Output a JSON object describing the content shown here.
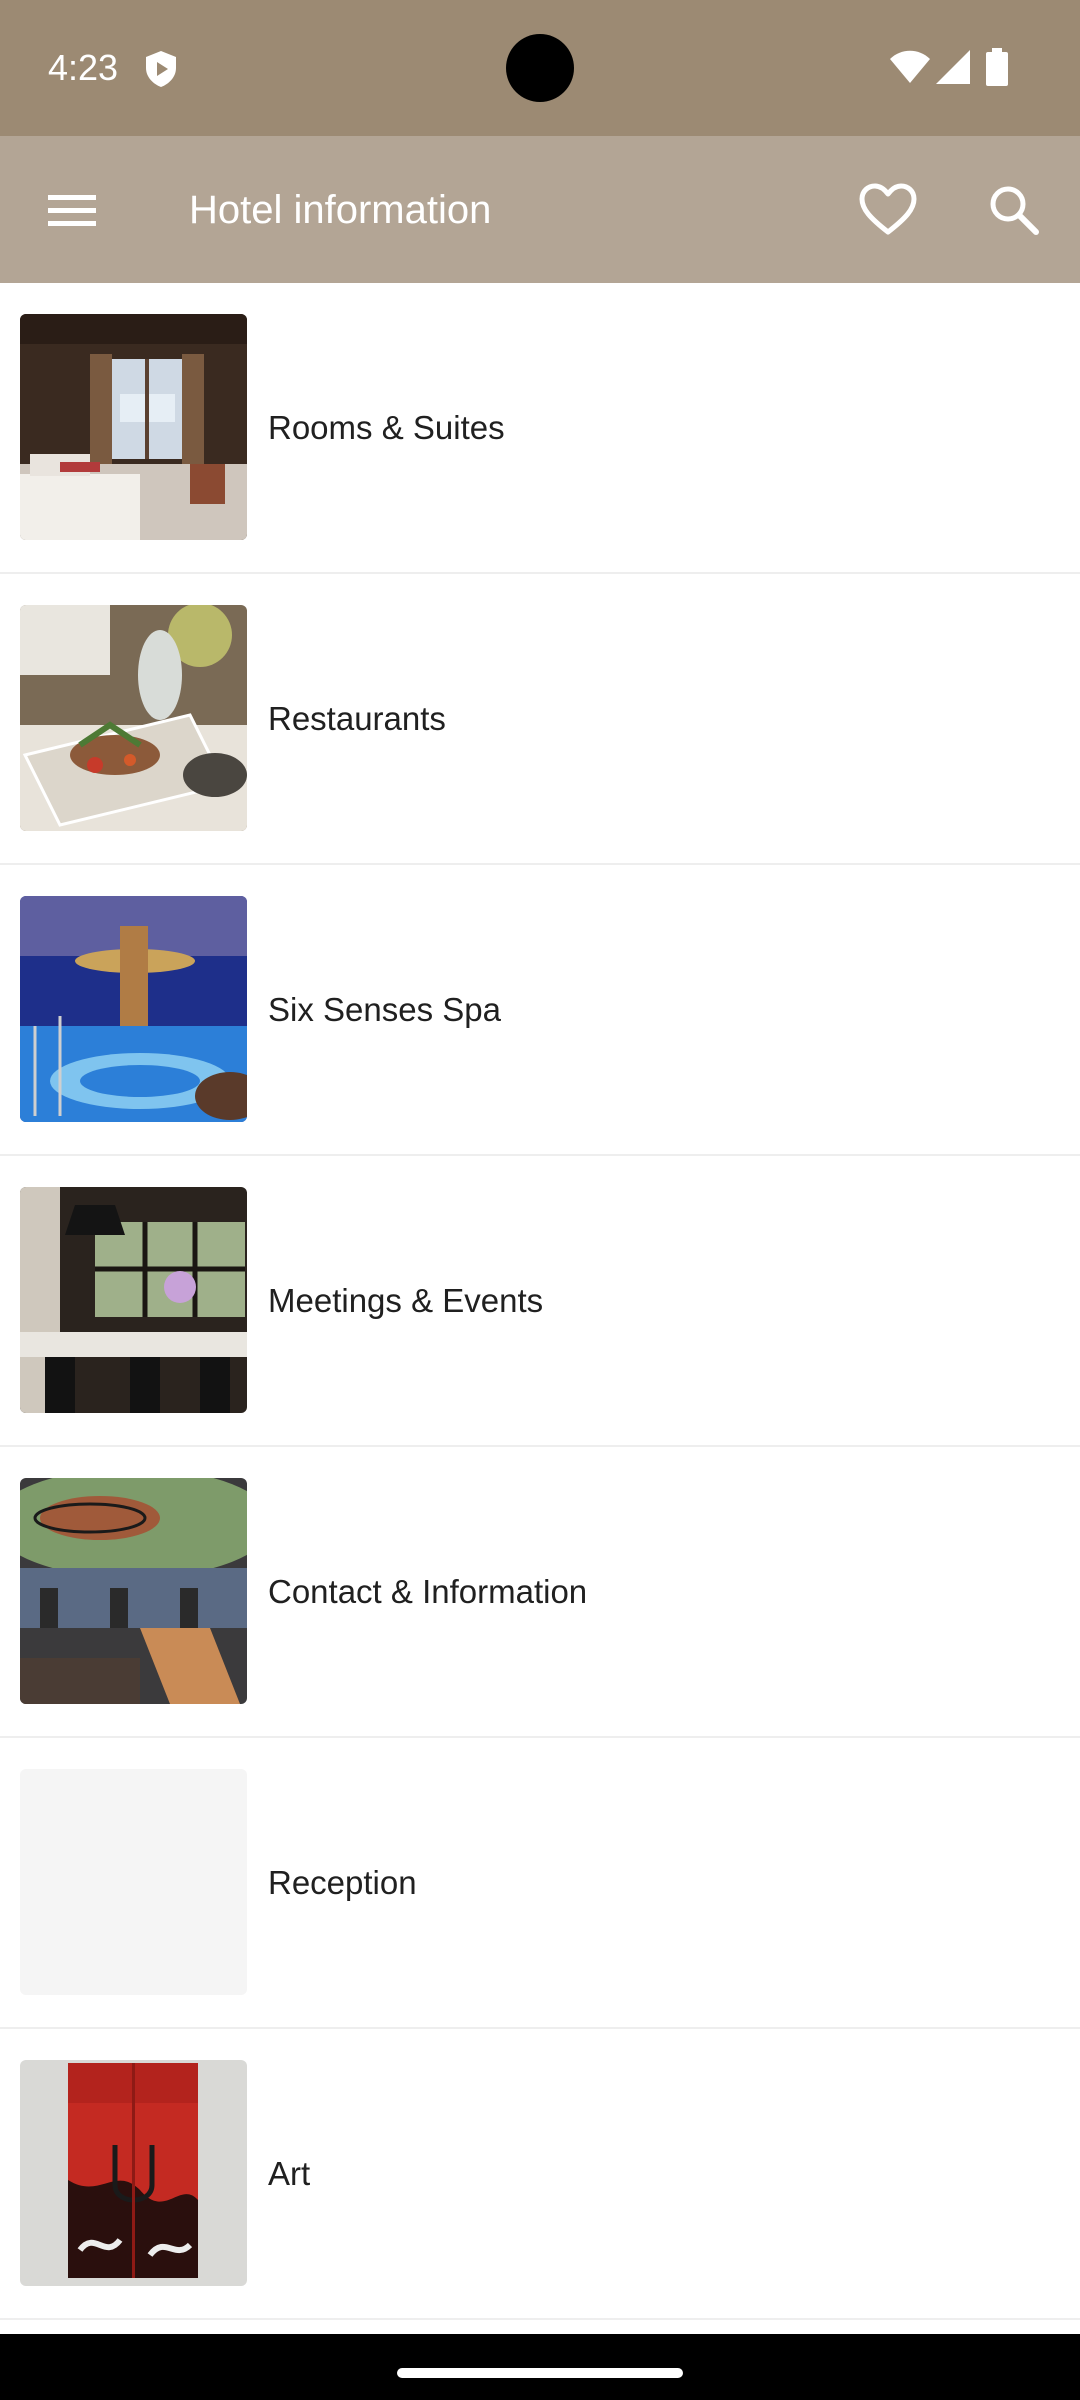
{
  "status_bar": {
    "time": "4:23",
    "icons": [
      "shield-play-icon",
      "wifi-icon",
      "signal-icon",
      "battery-icon"
    ]
  },
  "app_bar": {
    "title": "Hotel information",
    "icons": [
      "menu-icon",
      "heart-icon",
      "search-icon"
    ],
    "background_color": "#b3a595",
    "status_color": "#9c8a73"
  },
  "list": {
    "items": [
      {
        "label": "Rooms & Suites",
        "image": "hotel-room-photo"
      },
      {
        "label": "Restaurants",
        "image": "plated-food-photo"
      },
      {
        "label": "Six Senses Spa",
        "image": "spa-pool-photo"
      },
      {
        "label": "Meetings & Events",
        "image": "meeting-room-photo"
      },
      {
        "label": "Contact & Information",
        "image": "lobby-photo"
      },
      {
        "label": "Reception",
        "image": "placeholder-blank"
      },
      {
        "label": "Art",
        "image": "red-artwork-photo"
      }
    ]
  }
}
